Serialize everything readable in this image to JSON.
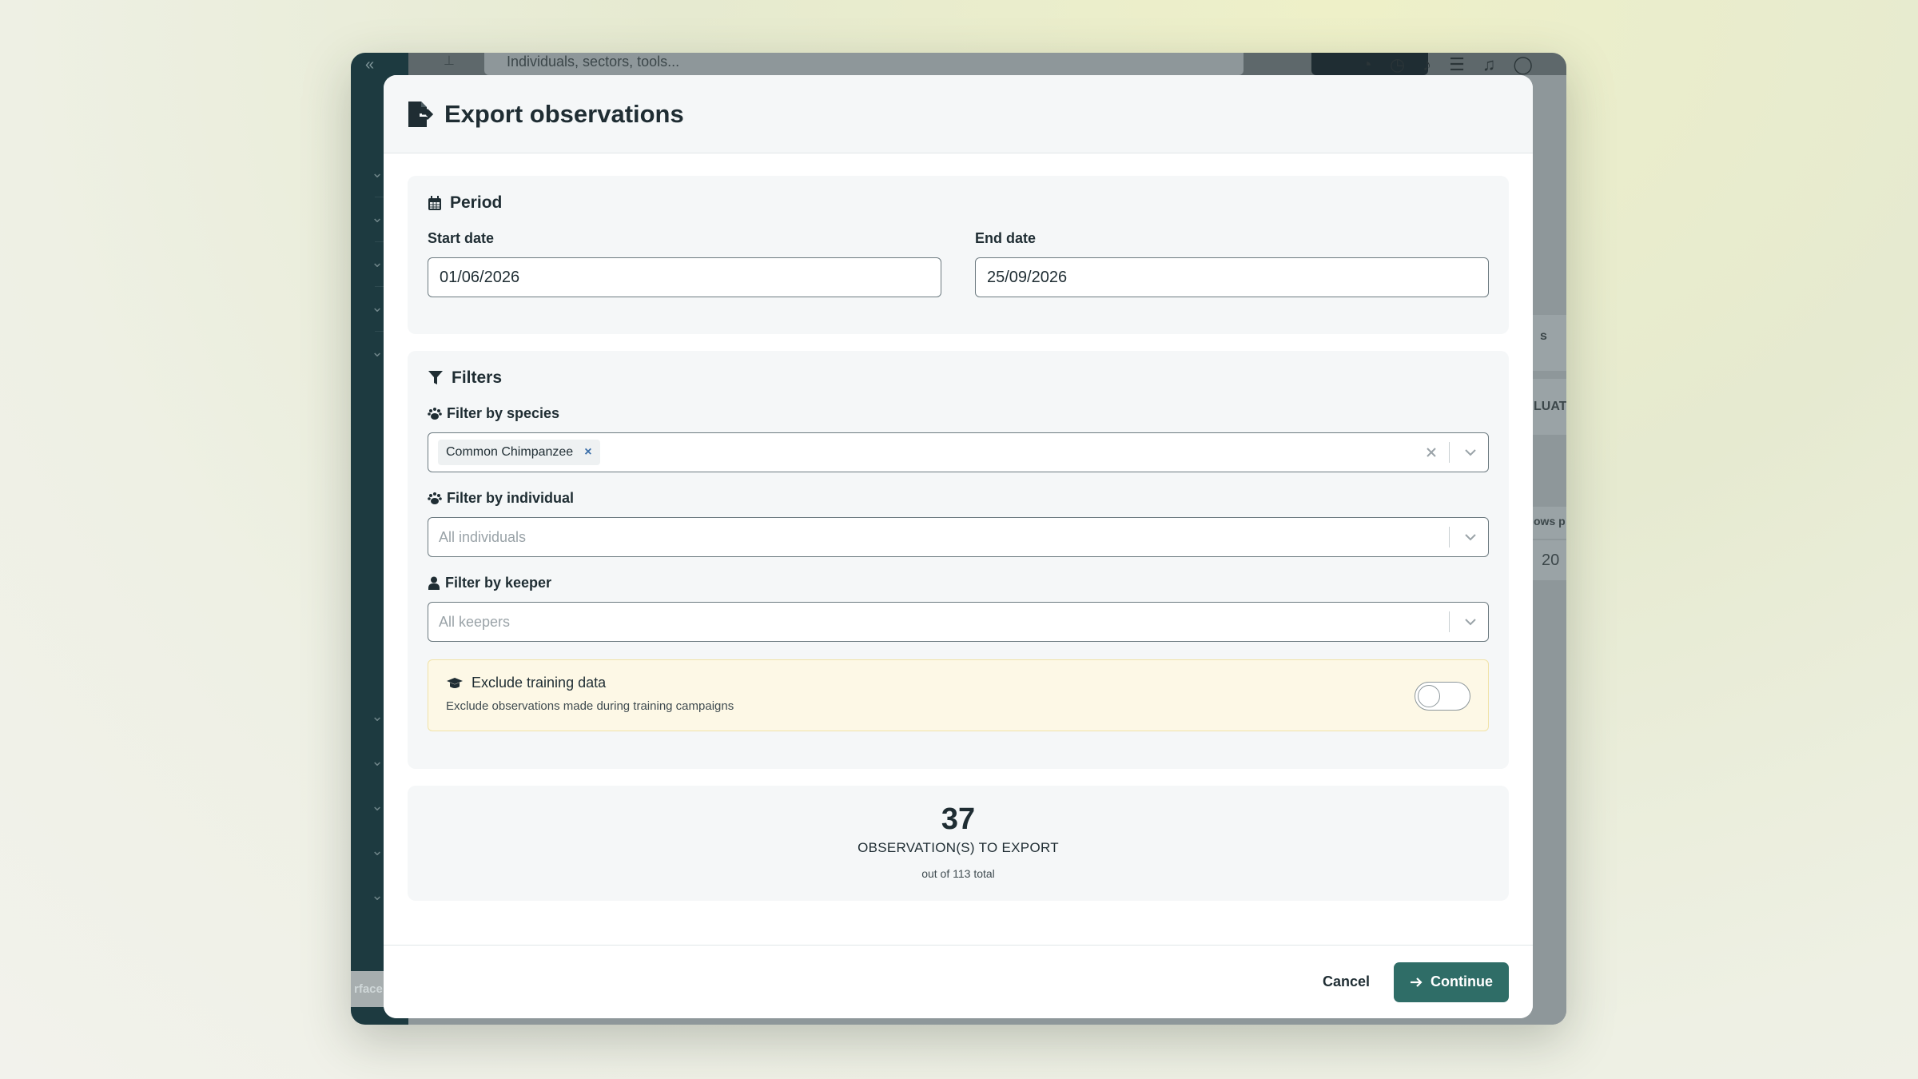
{
  "background_app": {
    "search_placeholder": "Individuals, sectors, tools...",
    "sidebar_footer_label": "rface",
    "right_strip_label_1": "s",
    "right_strip_label_2": "LUAT",
    "right_strip_label_3": "ows p",
    "right_strip_value": "20"
  },
  "modal": {
    "title": "Export observations",
    "period": {
      "title": "Period",
      "start_label": "Start date",
      "start_value": "01/06/2026",
      "end_label": "End date",
      "end_value": "25/09/2026"
    },
    "filters": {
      "title": "Filters",
      "species_label": "Filter by species",
      "species_selected": [
        "Common Chimpanzee"
      ],
      "individual_label": "Filter by individual",
      "individual_placeholder": "All individuals",
      "keeper_label": "Filter by keeper",
      "keeper_placeholder": "All keepers",
      "training_title": "Exclude training data",
      "training_subtitle": "Exclude observations made during training campaigns"
    },
    "summary": {
      "count": "37",
      "label": "OBSERVATION(S) TO EXPORT",
      "sub": "out of 113 total"
    },
    "footer": {
      "cancel_label": "Cancel",
      "continue_label": "Continue"
    }
  },
  "colors": {
    "accent": "#2f6d67",
    "training_bg": "#fdf8e6",
    "chip_remove": "#3a6ea8"
  }
}
